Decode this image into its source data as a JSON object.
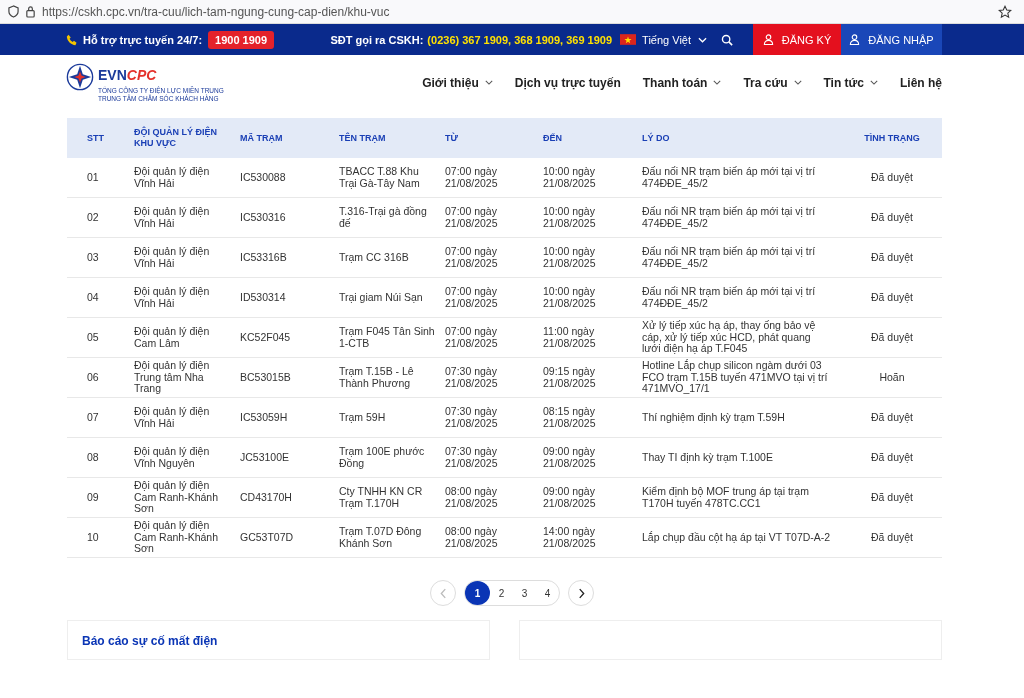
{
  "browser": {
    "url": "https://cskh.cpc.vn/tra-cuu/lich-tam-ngung-cung-cap-dien/khu-vuc"
  },
  "topbar": {
    "support_label": "Hỗ trợ trực tuyến 24/7:",
    "hotline": "1900 1909",
    "cskh_label": "SĐT gọi ra CSKH:",
    "cskh_numbers": "(0236) 367 1909, 368 1909, 369 1909",
    "language": "Tiếng Việt",
    "register": "ĐĂNG KÝ",
    "login": "ĐĂNG NHẬP"
  },
  "logo": {
    "brand_a": "EVN",
    "brand_b": "CPC",
    "line_1": "TỔNG CÔNG TY ĐIỆN LỰC MIỀN TRUNG",
    "line_2": "TRUNG TÂM CHĂM SÓC KHÁCH HÀNG"
  },
  "nav": [
    {
      "label": "Giới thiệu",
      "has_menu": true
    },
    {
      "label": "Dịch vụ trực tuyến",
      "has_menu": false
    },
    {
      "label": "Thanh toán",
      "has_menu": true
    },
    {
      "label": "Tra cứu",
      "has_menu": true
    },
    {
      "label": "Tin tức",
      "has_menu": true
    },
    {
      "label": "Liên hệ",
      "has_menu": false
    }
  ],
  "table": {
    "columns": [
      "STT",
      "ĐỘI QUẢN LÝ ĐIỆN KHU VỰC",
      "MÃ TRẠM",
      "TÊN TRẠM",
      "TỪ",
      "ĐẾN",
      "LÝ DO",
      "TÌNH TRẠNG"
    ],
    "rows": [
      [
        "01",
        "Đội quản lý điện Vĩnh Hải",
        "IC530088",
        "TBACC T.88 Khu Trại Gà-Tây Nam",
        "07:00 ngày 21/08/2025",
        "10:00 ngày 21/08/2025",
        "Đấu nối NR trạm biến áp mới tại vị trí 474ĐĐE_45/2",
        "Đã duyệt"
      ],
      [
        "02",
        "Đội quản lý điện Vĩnh Hải",
        "IC530316",
        "T.316-Trại gà đồng đế",
        "07:00 ngày 21/08/2025",
        "10:00 ngày 21/08/2025",
        "Đấu nối NR trạm biến áp mới tại vị trí 474ĐĐE_45/2",
        "Đã duyệt"
      ],
      [
        "03",
        "Đội quản lý điện Vĩnh Hải",
        "IC53316B",
        "Trạm CC 316B",
        "07:00 ngày 21/08/2025",
        "10:00 ngày 21/08/2025",
        "Đấu nối NR trạm biến áp mới tại vị trí 474ĐĐE_45/2",
        "Đã duyệt"
      ],
      [
        "04",
        "Đội quản lý điện Vĩnh Hải",
        "ID530314",
        "Trại giam Núi Sạn",
        "07:00 ngày 21/08/2025",
        "10:00 ngày 21/08/2025",
        "Đấu nối NR trạm biến áp mới tại vị trí 474ĐĐE_45/2",
        "Đã duyệt"
      ],
      [
        "05",
        "Đội quản lý điện Cam Lâm",
        "KC52F045",
        "Trạm F045 Tân Sinh 1-CTB",
        "07:00 ngày 21/08/2025",
        "11:00 ngày 21/08/2025",
        "Xử lý tiếp xúc hạ áp, thay ống bảo vệ cáp, xử lý tiếp xúc HCD, phát quang lưới điện hạ áp T.F045",
        "Đã duyệt"
      ],
      [
        "06",
        "Đội quản lý điện Trung tâm Nha Trang",
        "BC53015B",
        "Trạm T.15B - Lê Thành Phương",
        "07:30 ngày 21/08/2025",
        "09:15 ngày 21/08/2025",
        "Hotline Lắp chụp silicon ngàm dưới 03 FCO trạm T.15B tuyến 471MVO tại vị trí 471MVO_17/1",
        "Hoãn"
      ],
      [
        "07",
        "Đội quản lý điện Vĩnh Hải",
        "IC53059H",
        "Trạm 59H",
        "07:30 ngày 21/08/2025",
        "08:15 ngày 21/08/2025",
        "Thí nghiệm định kỳ trạm T.59H",
        "Đã duyệt"
      ],
      [
        "08",
        "Đội quản lý điện Vĩnh Nguyên",
        "JC53100E",
        "Trạm 100E phước Đồng",
        "07:30 ngày 21/08/2025",
        "09:00 ngày 21/08/2025",
        "Thay TI định kỳ trạm T.100E",
        "Đã duyệt"
      ],
      [
        "09",
        "Đội quản lý điện Cam Ranh-Khánh Sơn",
        "CD43170H",
        "Cty TNHH KN CR Trạm T.170H",
        "08:00 ngày 21/08/2025",
        "09:00 ngày 21/08/2025",
        "Kiểm định bộ MOF trung áp tại trạm T170H tuyến 478TC.CC1",
        "Đã duyệt"
      ],
      [
        "10",
        "Đội quản lý điện Cam Ranh-Khánh Sơn",
        "GC53T07D",
        "Trạm T.07D Đông Khánh Sơn",
        "08:00 ngày 21/08/2025",
        "14:00 ngày 21/08/2025",
        "Lắp chụp đầu cột hạ áp tại VT T07D-A-2",
        "Đã duyệt"
      ]
    ]
  },
  "pagination": {
    "prev": {
      "disabled": true
    },
    "next": {
      "disabled": false
    },
    "pages": [
      {
        "label": "1",
        "selected": true
      },
      {
        "label": "2",
        "selected": false
      },
      {
        "label": "3",
        "selected": false
      },
      {
        "label": "4",
        "selected": false
      }
    ]
  },
  "report_card": {
    "title": "Báo cáo sự cố mất điện"
  }
}
